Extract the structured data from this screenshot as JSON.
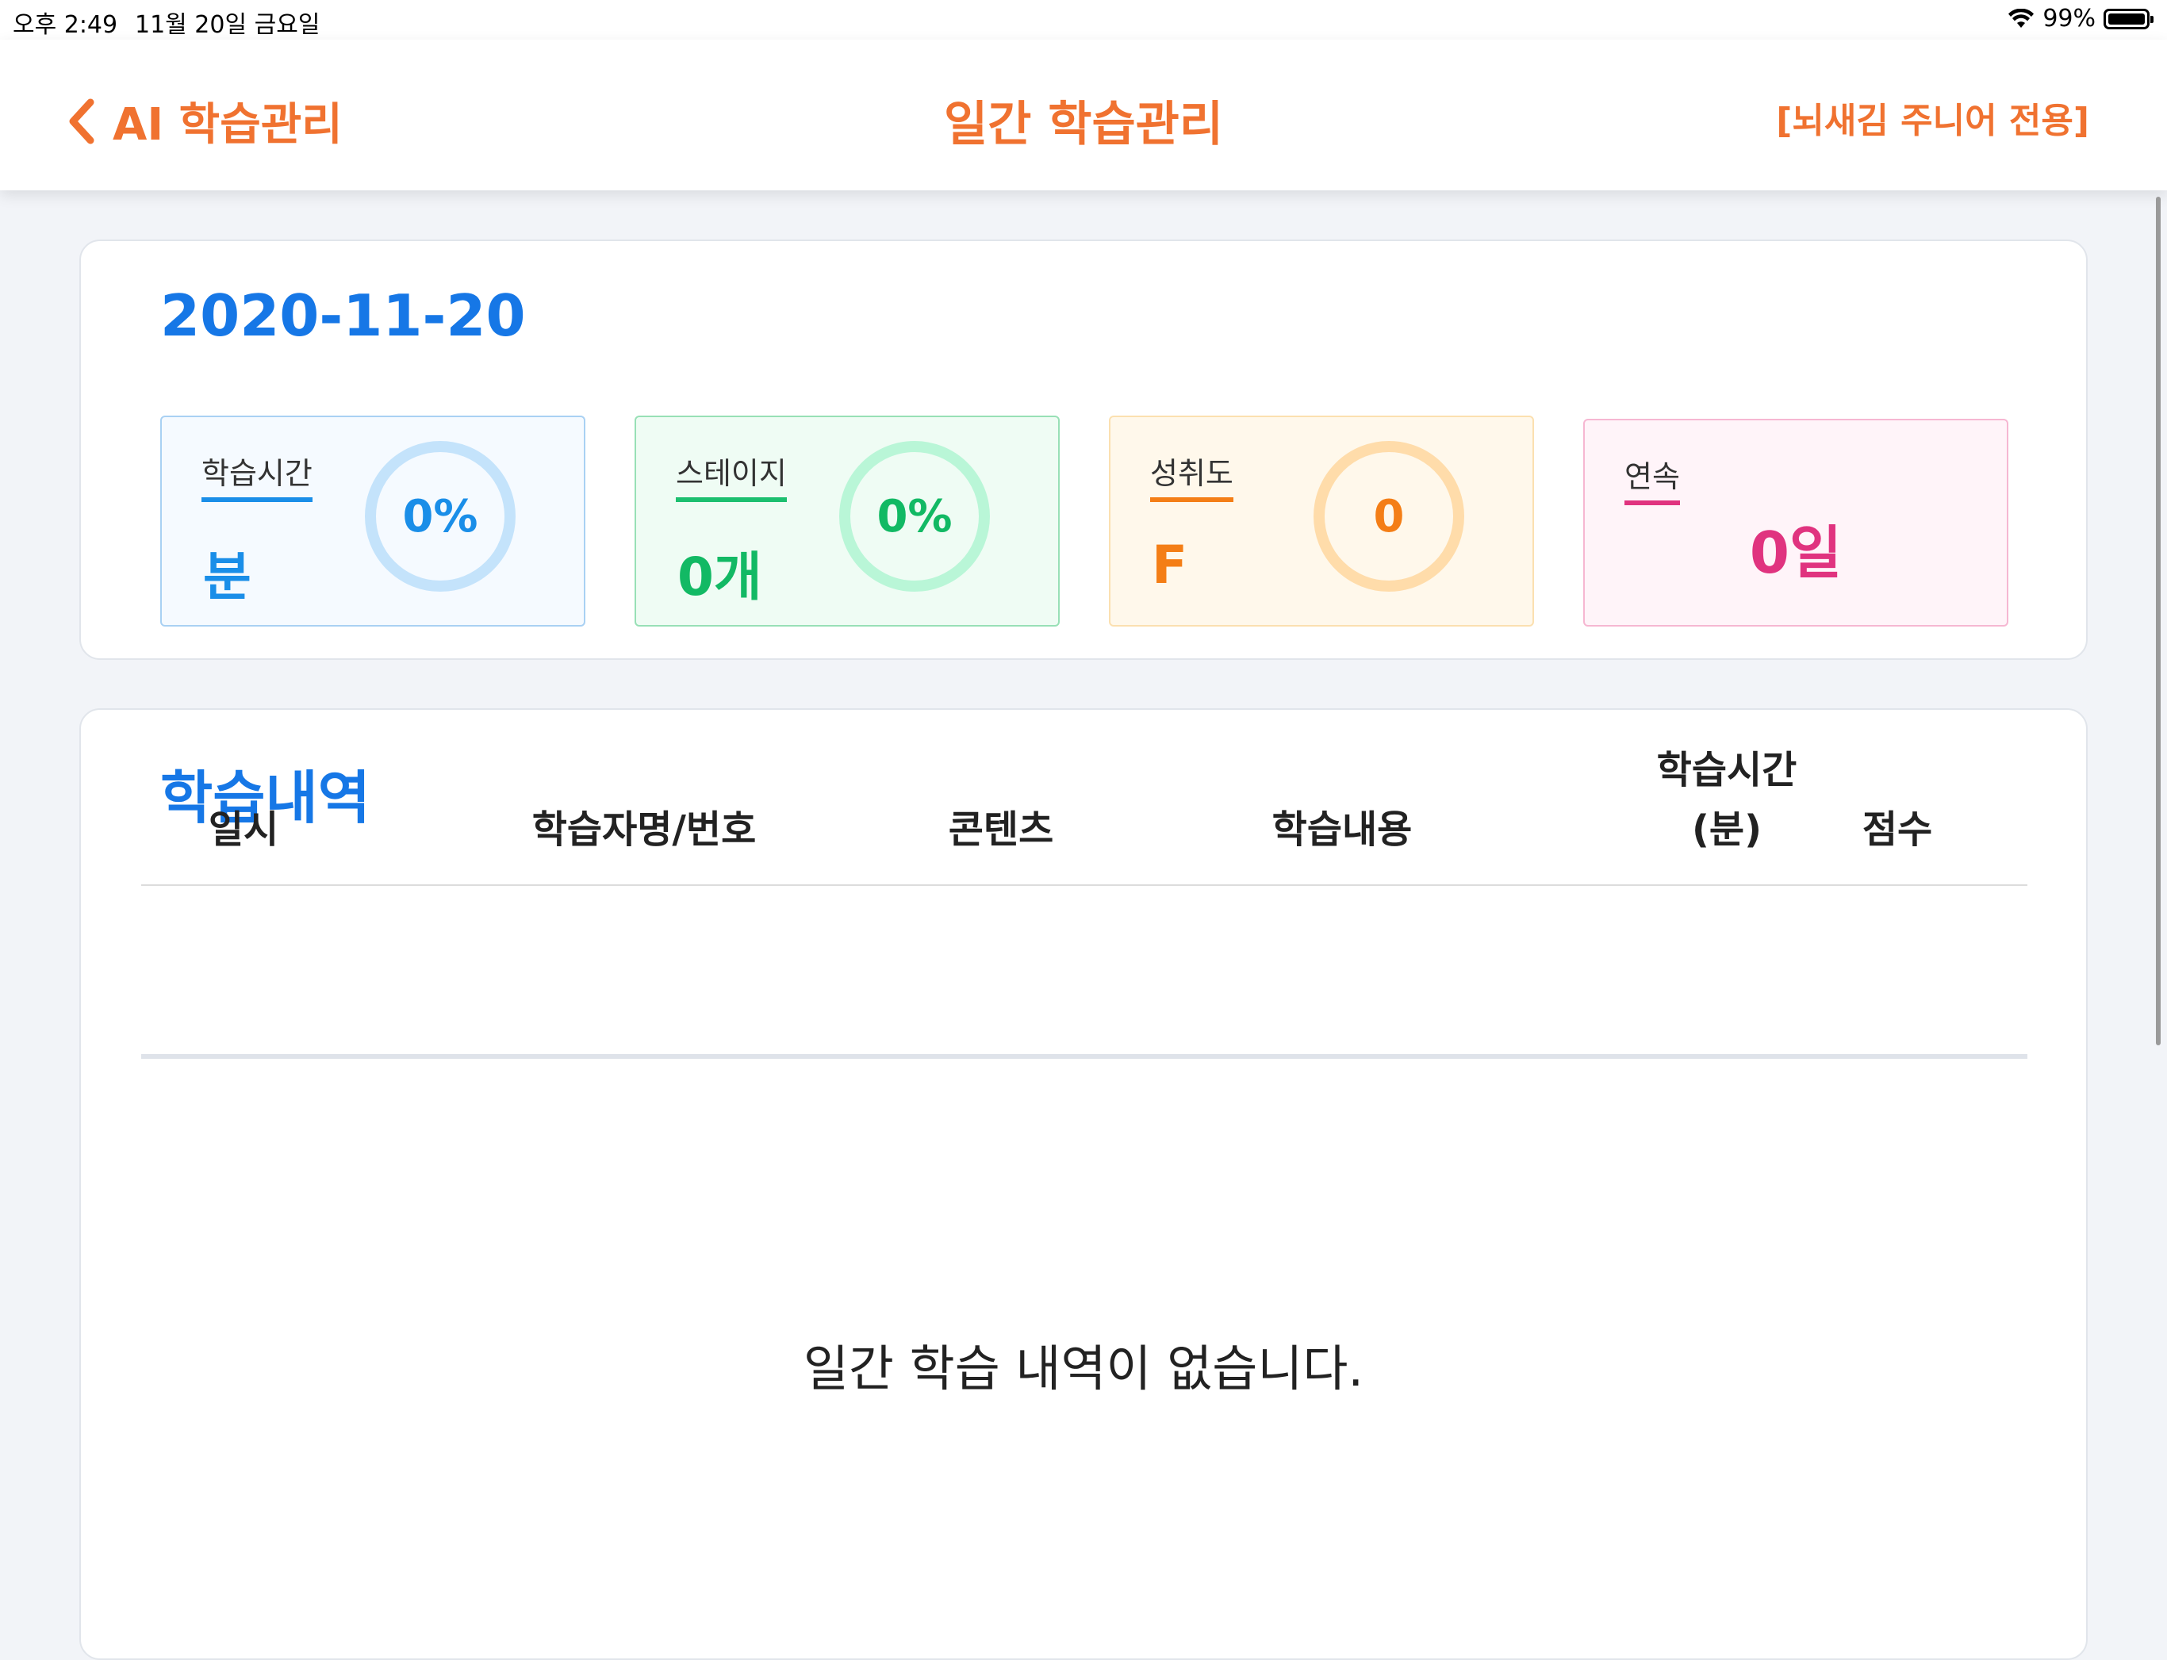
{
  "status_bar": {
    "time": "오후 2:49",
    "date": "11월 20일 금요일",
    "battery": "99%"
  },
  "nav": {
    "back_label": "AI 학습관리",
    "title": "일간 학습관리",
    "right_label": "[뇌새김 주니어 전용]"
  },
  "summary": {
    "date": "2020-11-20",
    "stats": {
      "time": {
        "label": "학습시간",
        "value": "분",
        "percent": "0%"
      },
      "stage": {
        "label": "스테이지",
        "value": "0개",
        "percent": "0%"
      },
      "achievement": {
        "label": "성취도",
        "value": "F",
        "score": "0"
      },
      "streak": {
        "label": "연속",
        "value": "0일"
      }
    }
  },
  "history": {
    "title": "학습내역",
    "columns": {
      "date": "일시",
      "learner": "학습자명/번호",
      "content": "콘텐츠",
      "detail": "학습내용",
      "time_line1": "학습시간",
      "time_line2": "(분)",
      "score": "점수"
    },
    "rows": [],
    "empty_message": "일간 학습 내역이 없습니다."
  },
  "colors": {
    "accent_orange": "#f07230",
    "title_blue": "#1677e6",
    "time_blue": "#1a8ee8",
    "stage_green": "#12b964",
    "achieve_orange": "#f47e16",
    "streak_pink": "#e0337f"
  }
}
